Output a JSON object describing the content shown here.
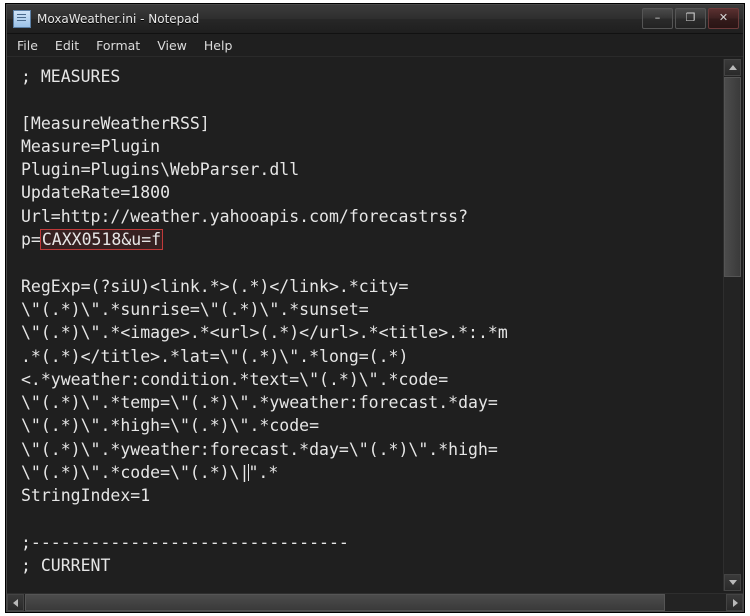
{
  "window": {
    "title": "MoxaWeather.ini - Notepad",
    "icon": "notepad-icon",
    "buttons": {
      "minimize": "–",
      "maximize": "❐",
      "close": "✕"
    }
  },
  "menubar": {
    "items": [
      {
        "label": "File"
      },
      {
        "label": "Edit"
      },
      {
        "label": "Format"
      },
      {
        "label": "View"
      },
      {
        "label": "Help"
      }
    ]
  },
  "editor": {
    "lines": [
      "; MEASURES",
      "",
      "[MeasureWeatherRSS]",
      "Measure=Plugin",
      "Plugin=Plugins\\WebParser.dll",
      "UpdateRate=1800",
      "Url=http://weather.yahooapis.com/forecastrss?",
      "p=CAXX0518&u=f",
      "",
      "RegExp=(?siU)<link.*>(.*)</link>.*city=",
      "\\\"(.*)\\\".*sunrise=\\\"(.*)\\\".*sunset=",
      "\\\"(.*)\\\".*<image>.*<url>(.*)</url>.*<title>.*:.*m",
      ".*(.*)</title>.*lat=\\\"(.*)\\\".*long=(.*)",
      "<.*yweather:condition.*text=\\\"(.*)\\\".*code=",
      "\\\"(.*)\\\".*temp=\\\"(.*)\\\".*yweather:forecast.*day=",
      "\\\"(.*)\\\".*high=\\\"(.*)\\\".*code=",
      "\\\"(.*)\\\".*yweather:forecast.*day=\\\"(.*)\\\".*high=",
      "\\\"(.*)\\\".*code=\\\"(.*)\\|\".*",
      "StringIndex=1",
      "",
      ";--------------------------------",
      "; CURRENT"
    ],
    "selection": {
      "line_index": 7,
      "prefix": "p=",
      "selected_text": "CAXX0518&u=f"
    }
  }
}
